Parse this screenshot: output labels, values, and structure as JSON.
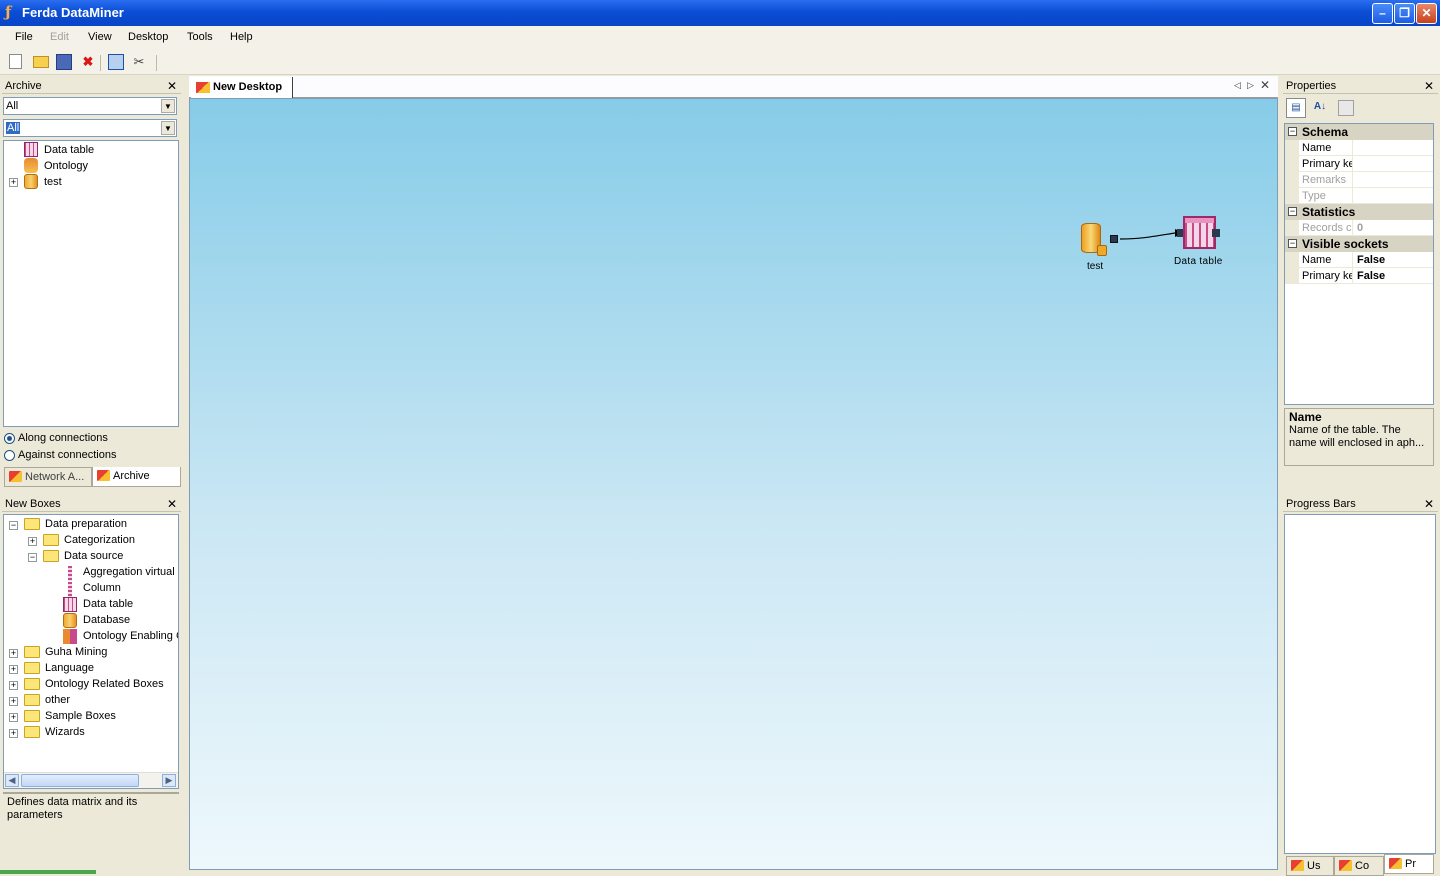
{
  "window": {
    "title": "Ferda DataMiner"
  },
  "menu": [
    "File",
    "Edit",
    "View",
    "Desktop",
    "Tools",
    "Help"
  ],
  "archive": {
    "title": "Archive",
    "filter1": "All",
    "filter2": "All",
    "items": [
      "Data table",
      "Ontology",
      "test"
    ],
    "radio_along": "Along connections",
    "radio_against": "Against connections",
    "tabs": [
      "Network A...",
      "Archive"
    ]
  },
  "newboxes": {
    "title": "New Boxes",
    "tree": [
      "Data preparation",
      "Categorization",
      "Data source",
      "Aggregation virtual c",
      "Column",
      "Data table",
      "Database",
      "Ontology Enabling C",
      "Guha Mining",
      "Language",
      "Ontology Related Boxes",
      "other",
      "Sample Boxes",
      "Wizards"
    ],
    "description": "Defines data matrix and its parameters"
  },
  "desktop": {
    "tab": "New Desktop",
    "nodes": {
      "test": "test",
      "datatable": "Data table"
    }
  },
  "properties": {
    "title": "Properties",
    "cat_schema": "Schema",
    "schema": {
      "name": "Name",
      "primary": "Primary ke",
      "remarks": "Remarks",
      "type": "Type"
    },
    "cat_statistics": "Statistics",
    "statistics": {
      "records": "Records c",
      "records_val": "0"
    },
    "cat_visible": "Visible sockets",
    "visible": {
      "name": "Name",
      "name_val": "False",
      "primary": "Primary ke",
      "primary_val": "False"
    },
    "help_title": "Name",
    "help_text": "Name of the table. The name will enclosed in aph..."
  },
  "progress": {
    "title": "Progress Bars",
    "tabs": [
      "Us",
      "Co",
      "Pr"
    ]
  }
}
